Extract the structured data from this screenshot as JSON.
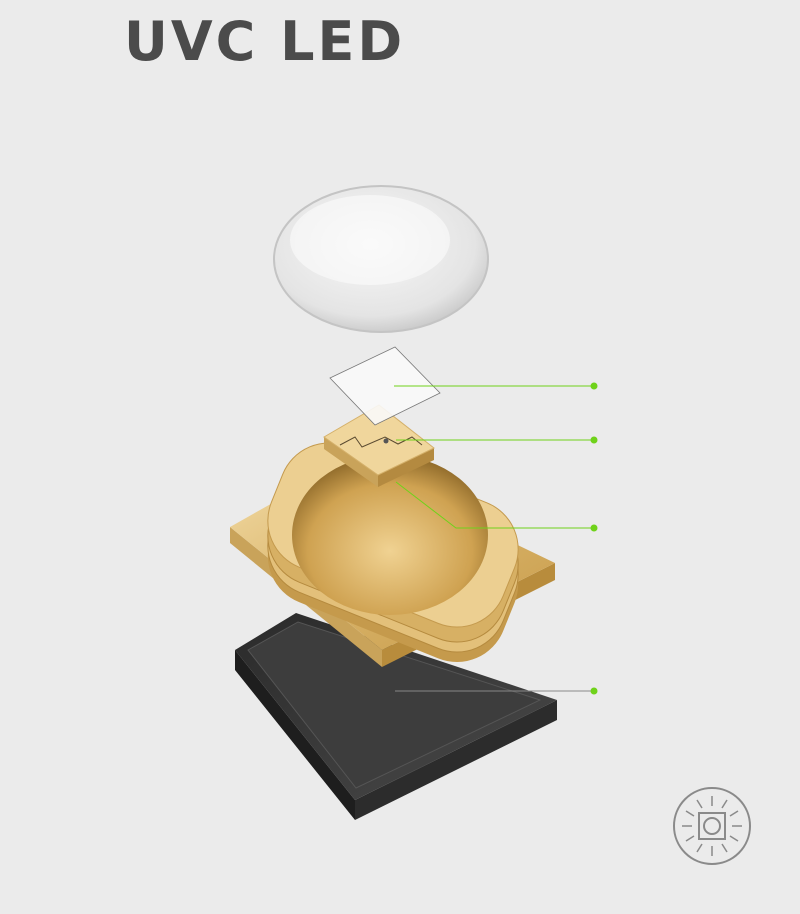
{
  "title": "UVC LED",
  "colors": {
    "background": "#ebebeb",
    "title": "#4b4b4b",
    "callout": "#6fd21a",
    "gold": "#e6c47f",
    "tray": "#3a3a3a",
    "icon": "#8a8a8a"
  },
  "callouts": [
    {
      "part": "glass-window"
    },
    {
      "part": "uvc-chip"
    },
    {
      "part": "chip-substrate"
    },
    {
      "part": "base-tray"
    }
  ],
  "badge_icon": "uv-led-light-icon"
}
